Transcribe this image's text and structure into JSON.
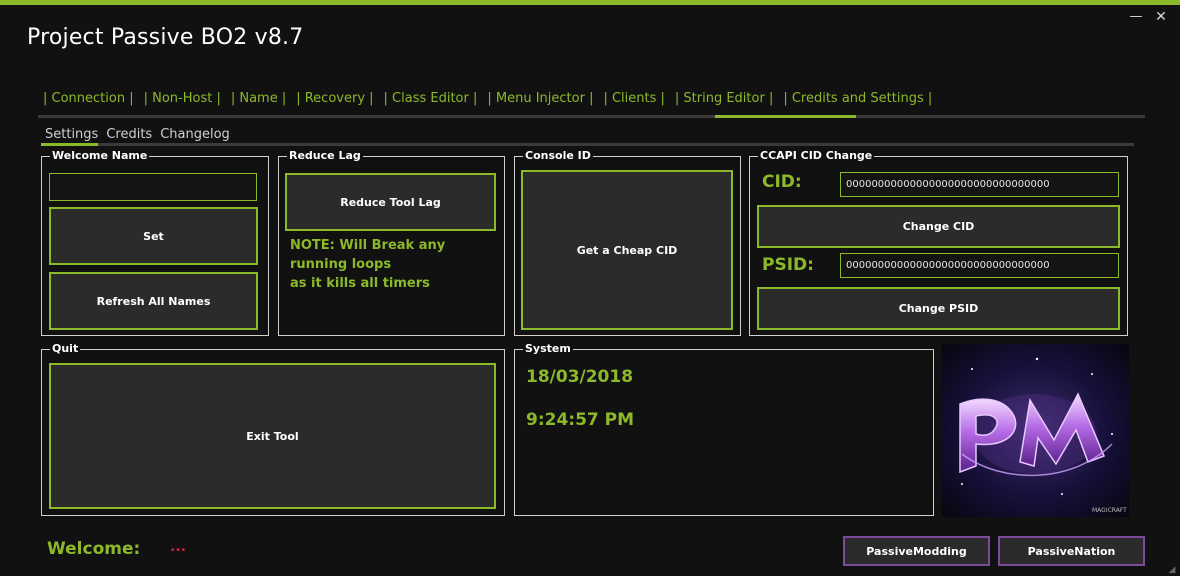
{
  "window": {
    "title": "Project Passive BO2 v8.7",
    "minimize": "—",
    "close": "✕"
  },
  "tabs": [
    {
      "label": "| Connection |"
    },
    {
      "label": "| Non-Host |"
    },
    {
      "label": "| Name |"
    },
    {
      "label": "| Recovery |"
    },
    {
      "label": "| Class Editor |"
    },
    {
      "label": "| Menu Injector |"
    },
    {
      "label": "| Clients |"
    },
    {
      "label": "| String Editor |"
    },
    {
      "label": "| Credits and Settings |"
    }
  ],
  "active_tab": "| Credits and Settings |",
  "subtabs": [
    {
      "label": "Settings"
    },
    {
      "label": "Credits"
    },
    {
      "label": "Changelog"
    }
  ],
  "active_subtab": "Settings",
  "welcome_name": {
    "title": "Welcome Name",
    "input_value": "",
    "set_label": "Set",
    "refresh_label": "Refresh All Names"
  },
  "reduce_lag": {
    "title": "Reduce Lag",
    "button_label": "Reduce Tool Lag",
    "note_line1": "NOTE: Will Break any",
    "note_line2": "running loops",
    "note_line3": "as it kills all timers"
  },
  "console_id": {
    "title": "Console ID",
    "button_label": "Get a Cheap CID"
  },
  "ccapi": {
    "title": "CCAPI CID Change",
    "cid_label": "CID:",
    "cid_value": "00000000000000000000000000000000",
    "change_cid_label": "Change CID",
    "psid_label": "PSID:",
    "psid_value": "00000000000000000000000000000000",
    "change_psid_label": "Change PSID"
  },
  "quit": {
    "title": "Quit",
    "exit_label": "Exit Tool"
  },
  "system": {
    "title": "System",
    "date": "18/03/2018",
    "time": "9:24:57 PM"
  },
  "logo": {
    "icon": "pm-logo",
    "text": "PM",
    "caption": "MAGICRAFT"
  },
  "footer": {
    "welcome_label": "Welcome:",
    "welcome_value": "...",
    "passive_modding_label": "PassiveModding",
    "passive_nation_label": "PassiveNation"
  },
  "colors": {
    "accent": "#8cb92a",
    "background": "#111111",
    "button_bg": "#2b2b2b",
    "purple_border": "#7b4a9a",
    "welcome_value": "#d0203a"
  }
}
